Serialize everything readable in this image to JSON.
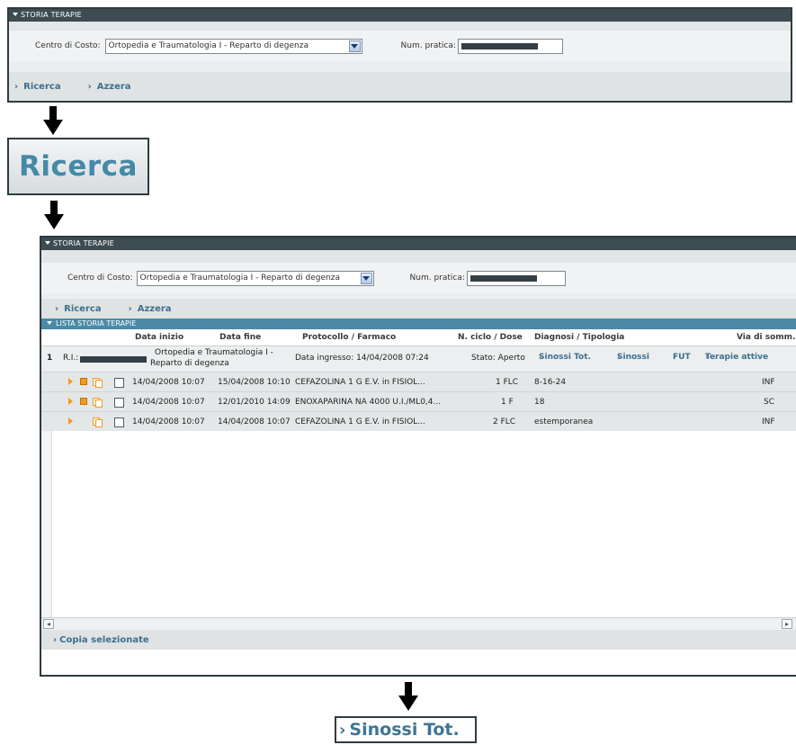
{
  "top_panel": {
    "title": "STORIA TERAPIE",
    "centro_label": "Centro di Costo:",
    "centro_value": "Ortopedia e Traumatologia I - Reparto di degenza",
    "pratica_label": "Num. pratica:",
    "link_ricerca": "Ricerca",
    "link_azzera": "Azzera"
  },
  "zoom_ricerca": "Ricerca",
  "results_panel": {
    "title": "STORIA TERAPIE",
    "centro_label": "Centro di Costo:",
    "centro_value": "Ortopedia e Traumatologia I - Reparto di degenza",
    "pratica_label": "Num. pratica:",
    "link_ricerca": "Ricerca",
    "link_azzera": "Azzera",
    "list_title": "LISTA STORIA TERAPIE",
    "columns": {
      "data_inizio": "Data inizio",
      "data_fine": "Data fine",
      "protocollo": "Protocollo / Farmaco",
      "ciclo": "N. ciclo / Dose",
      "diagnosi": "Diagnosi / Tipologia",
      "via": "Via di somm."
    },
    "ricovero": {
      "num": "1",
      "ri_label": "R.I.:",
      "reparto_line1": "Ortopedia e Traumatologia I -",
      "reparto_line2": "Reparto di degenza",
      "ingresso": "Data ingresso: 14/04/2008 07:24",
      "stato": "Stato: Aperto",
      "link_sinossi_tot": "Sinossi Tot.",
      "link_sinossi": "Sinossi",
      "link_fut": "FUT",
      "link_terapie": "Terapie attive"
    },
    "rows": [
      {
        "inizio": "14/04/2008 10:07",
        "fine": "15/04/2008 10:10",
        "farmaco": "CEFAZOLINA 1 G E.V. in FISIOL...",
        "dose": "1 FLC",
        "diagnosi": "8-16-24",
        "via": "INF"
      },
      {
        "inizio": "14/04/2008 10:07",
        "fine": "12/01/2010 14:09",
        "farmaco": "ENOXAPARINA NA 4000 U.I./ML0,4...",
        "dose": "1 F",
        "diagnosi": "18",
        "via": "SC"
      },
      {
        "inizio": "14/04/2008 10:07",
        "fine": "14/04/2008 10:07",
        "farmaco": "CEFAZOLINA 1 G E.V. in FISIOL...",
        "dose": "2 FLC",
        "diagnosi": "estemporanea",
        "via": "INF"
      }
    ],
    "copia_link": "Copia selezionate"
  },
  "zoom_sinossi": "Sinossi Tot.",
  "colors": {
    "header_dark": "#3d4c52",
    "list_header": "#4a8aa6",
    "link": "#3d6f8e",
    "accent_orange": "#f29a1f"
  }
}
